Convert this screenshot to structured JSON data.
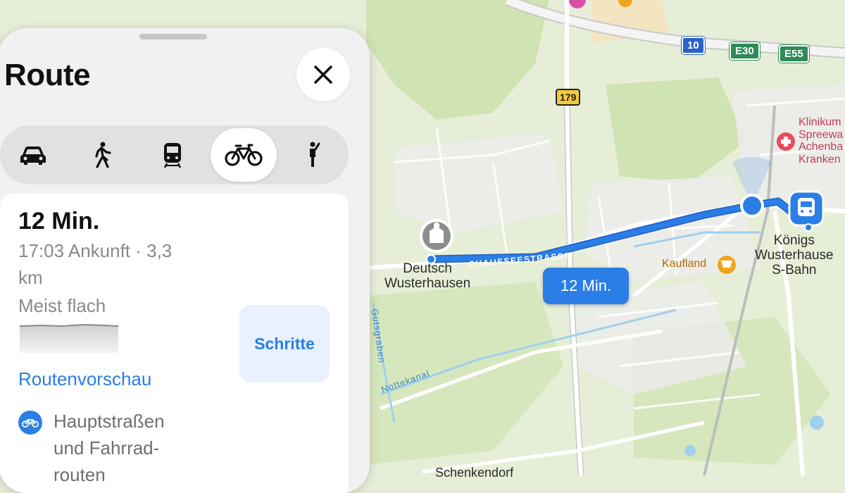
{
  "panel": {
    "title": "Route",
    "modes": [
      {
        "name": "car-icon",
        "active": false
      },
      {
        "name": "walk-icon",
        "active": false
      },
      {
        "name": "transit-icon",
        "active": false
      },
      {
        "name": "bike-icon",
        "active": true
      },
      {
        "name": "ride-icon",
        "active": false
      }
    ],
    "route": {
      "eta": "12 Min.",
      "arrival_line1": "17:03 Ankunft · 3,3",
      "arrival_line2": "km",
      "terrain": "Meist flach",
      "steps_label": "Schritte",
      "preview_label": "Routenvorschau",
      "note_line1": "Hauptstraßen",
      "note_line2": "und Fahrrad-",
      "note_line3": "routen"
    }
  },
  "map": {
    "eta_bubble": "12 Min.",
    "street_label": "CHAUSSEESTRASSE",
    "place_start_1": "Deutsch",
    "place_start_2": "Wusterhausen",
    "place_end_1": "Königs",
    "place_end_2": "Wusterhause",
    "place_end_3": "S-Bahn",
    "kaufland": "Kaufland",
    "klinikum_1": "Klinikum",
    "klinikum_2": "Spreewa",
    "klinikum_3": "Achenba",
    "klinikum_4": "Kranken",
    "gutsgraben": "Gutsgraben",
    "nottekanal": "Nottekanal",
    "schenkendorf": "Schenkendorf",
    "shield_10": "10",
    "shield_e30": "E30",
    "shield_e55": "E55",
    "shield_179": "179",
    "colors": {
      "route": "#2a7ee6",
      "land": "#e7eed7",
      "forest": "#cfe3b3",
      "road": "#ffffff",
      "water": "#9fd0ee"
    }
  }
}
